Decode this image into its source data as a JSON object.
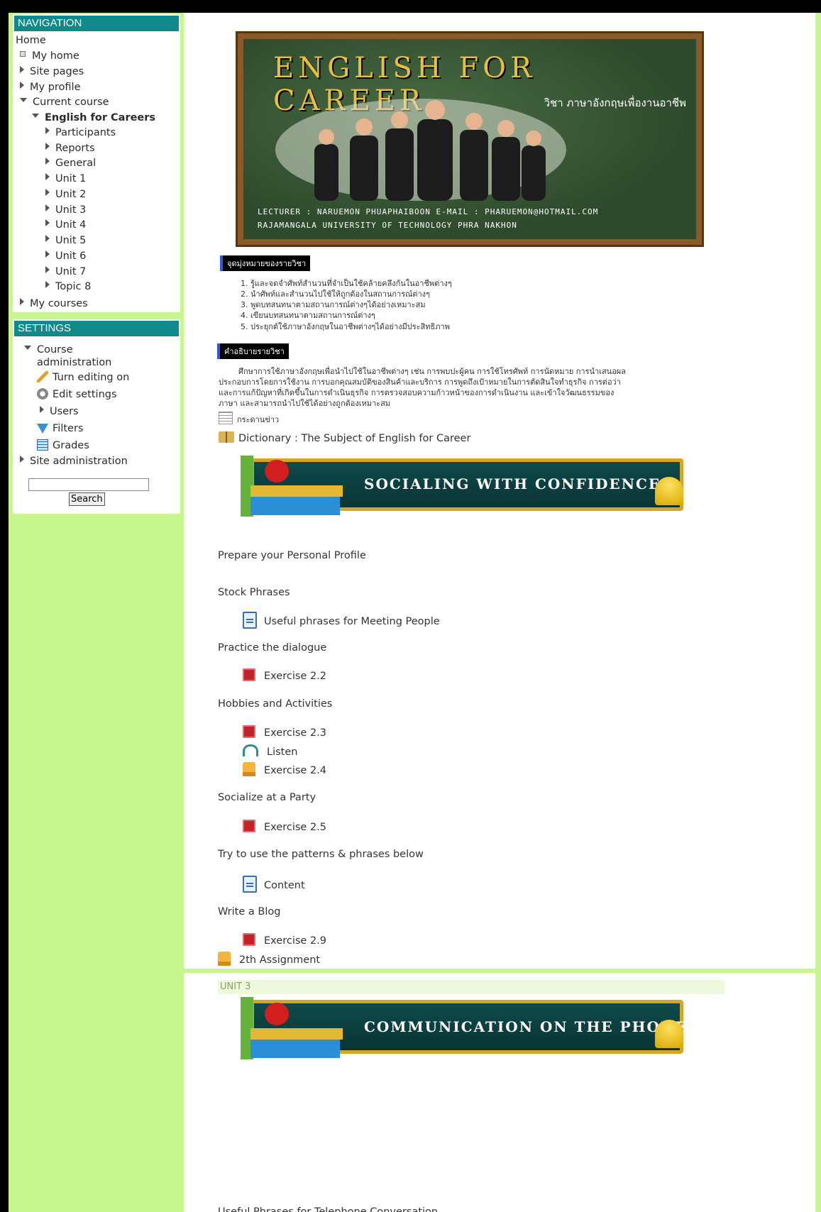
{
  "nav": {
    "title": "NAVIGATION",
    "home": "Home",
    "my_home": "My home",
    "site_pages": "Site pages",
    "my_profile": "My profile",
    "current_course": "Current course",
    "course_name": "English for Careers",
    "course_items": [
      "Participants",
      "Reports",
      "General",
      "Unit 1",
      "Unit 2",
      "Unit 3",
      "Unit 4",
      "Unit 5",
      "Unit 6",
      "Unit 7",
      "Topic 8"
    ],
    "my_courses": "My courses"
  },
  "settings": {
    "title": "SETTINGS",
    "course_admin": "Course administration",
    "turn_editing": "Turn editing on",
    "edit_settings": "Edit settings",
    "users": "Users",
    "filters": "Filters",
    "grades": "Grades",
    "site_admin": "Site administration",
    "search_button": "Search"
  },
  "banner": {
    "title": "ENGLISH FOR CAREER",
    "subtitle_th": "วิชา ภาษาอังกฤษเพื่องานอาชีพ",
    "lecturer": "LECTURER : NARUEMON PHUAPHAIBOON E-MAIL : PHARUEMON@HOTMAIL.COM",
    "university": "RAJAMANGALA UNIVERSITY OF TECHNOLOGY PHRA NAKHON"
  },
  "objectives": {
    "heading": "จุดมุ่งหมายของรายวิชา",
    "items": [
      "1.  รู้และจดจำศัพท์สำนวนที่จำเป็นใช้คล้ายคลึงกันในอาชีพต่างๆ",
      "2.  นำศัพท์และสำนวนไปใช้ให้ถูกต้องในสถานการณ์ต่างๆ",
      "3.  พูดบทสนทนาตามสถานการณ์ต่างๆได้อย่างเหมาะสม",
      "4.  เขียนบทสนทนาตามสถานการณ์ต่างๆ",
      "5.  ประยุกต์ใช้ภาษาอังกฤษในอาชีพต่างๆได้อย่างมีประสิทธิภาพ"
    ]
  },
  "description": {
    "heading": "คำอธิบายรายวิชา",
    "lines": [
      "        ศึกษาการใช้ภาษาอังกฤษเพื่อนำไปใช้ในอาชีพต่างๆ เช่น การพบปะผู้คน การใช้โทรศัพท์ การนัดหมาย การนำเสนอผล",
      "ประกอบการโดยการใช้งาน  การบอกคุณสมบัติของสินค้าและบริการ การพูดถึงเป้าหมายในการตัดสินใจทำธุรกิจ  การต่อว่า",
      "และการแก้ปัญหาที่เกิดขึ้นในการดำเนินธุรกิจ  การตรวจสอบความก้าวหน้าของการดำเนินงาน และเข้าใจวัฒนธรรมของ",
      "ภาษา และสามารถนำไปใช้ได้อย่างถูกต้องเหมาะสม"
    ]
  },
  "resources": {
    "forum": "กระดานข่าว",
    "dictionary": "Dictionary : The Subject of English for Career"
  },
  "unit2": {
    "banner": "SOCIALING WITH CONFIDENCE",
    "profile": "Prepare your Personal Profile",
    "stock": "Stock Phrases",
    "useful": "Useful phrases for Meeting People",
    "practice": "Practice the dialogue",
    "ex22": "Exercise 2.2",
    "hobbies": "Hobbies and Activities",
    "ex23": "Exercise 2.3",
    "listen": "Listen",
    "ex24": "Exercise 2.4",
    "party": "Socialize at a Party",
    "ex25": "Exercise 2.5",
    "patterns": "Try to use the patterns & phrases below",
    "content": "Content",
    "blog": "Write a Blog",
    "ex29": "Exercise 2.9",
    "assignment": "2th Assignment"
  },
  "unit3": {
    "label": "UNIT 3",
    "banner": "COMMUNICATION ON THE PHONE",
    "useful": "Useful Phrases for Telephone Conversation"
  }
}
